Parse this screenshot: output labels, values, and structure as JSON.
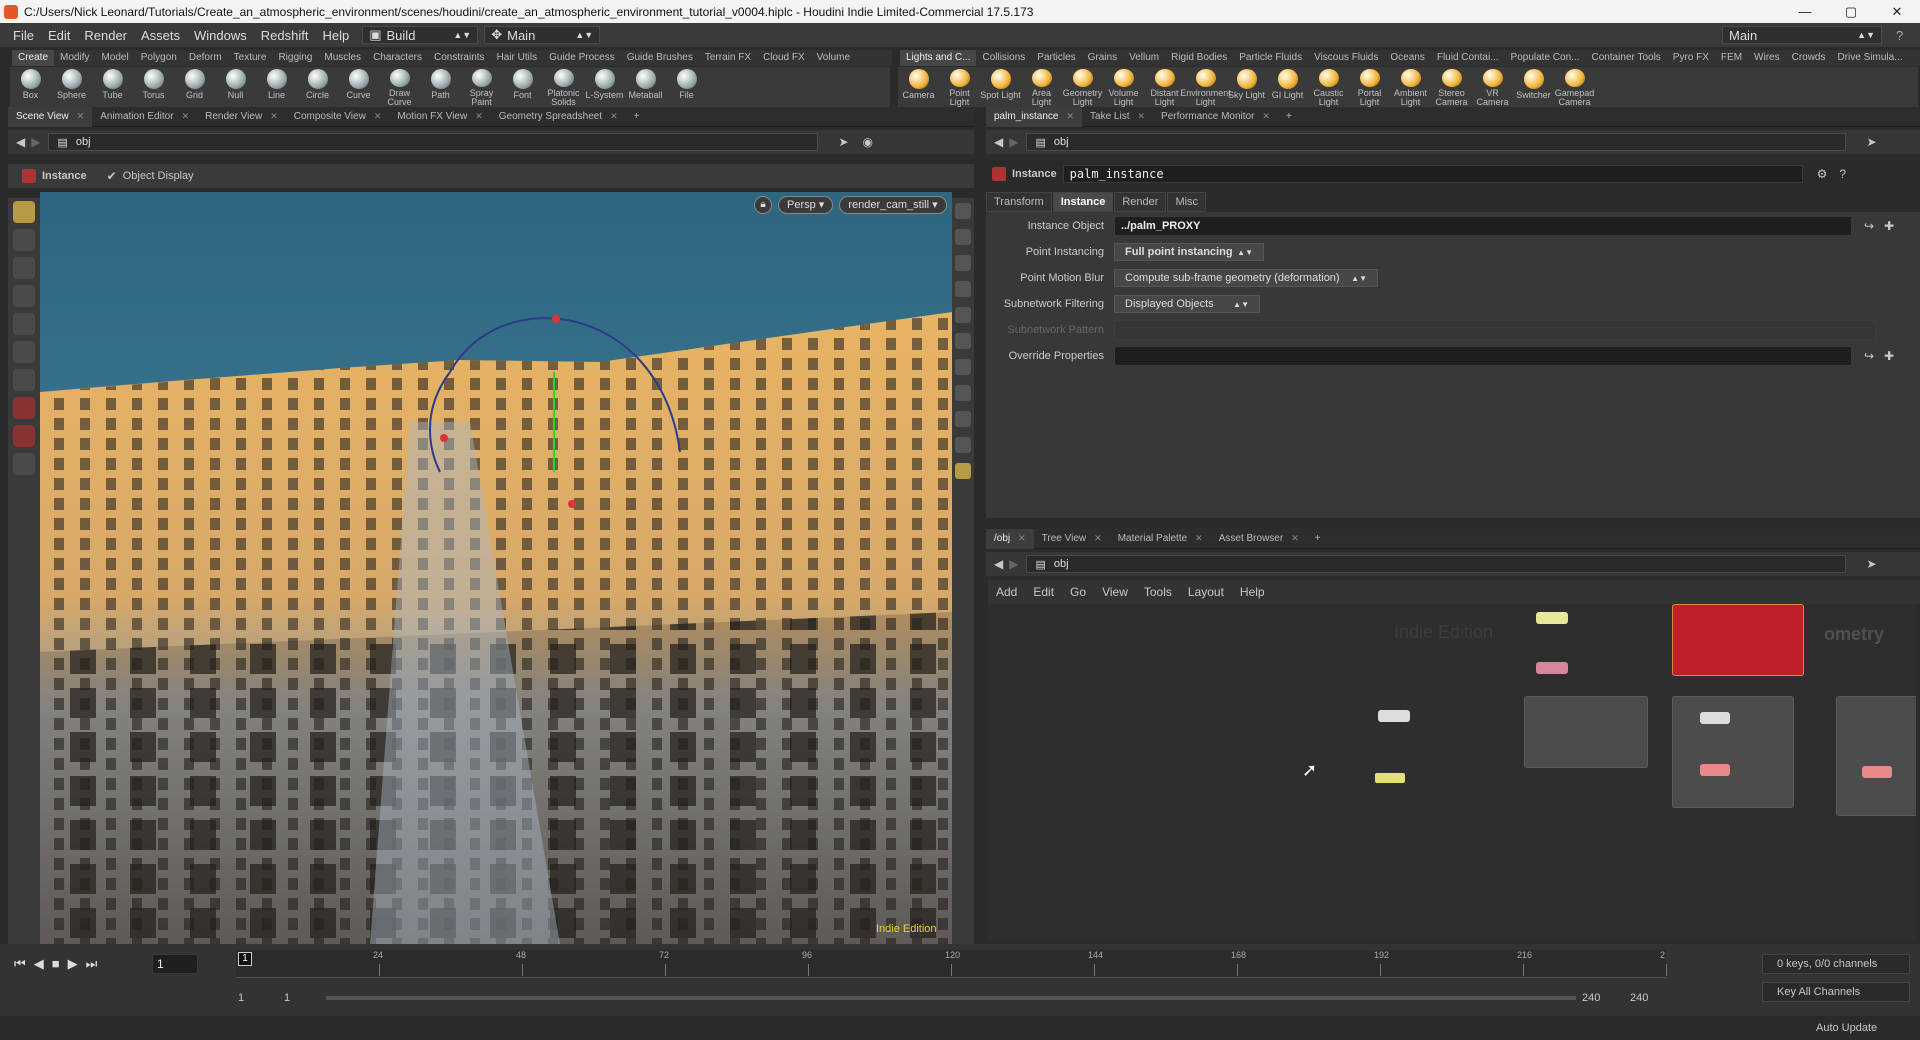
{
  "window": {
    "title": "C:/Users/Nick Leonard/Tutorials/Create_an_atmospheric_environment/scenes/houdini/create_an_atmospheric_environment_tutorial_v0004.hiplc - Houdini Indie Limited-Commercial 17.5.173",
    "min": "—",
    "max": "▢",
    "close": "✕"
  },
  "menu": [
    "File",
    "Edit",
    "Render",
    "Assets",
    "Windows",
    "Redshift",
    "Help"
  ],
  "desktop": {
    "build": "Build",
    "main": "Main",
    "right_main": "Main"
  },
  "shelf_tabs_left": [
    "Create",
    "Modify",
    "Model",
    "Polygon",
    "Deform",
    "Texture",
    "Rigging",
    "Muscles",
    "Characters",
    "Constraints",
    "Hair Utils",
    "Guide Process",
    "Guide Brushes",
    "Terrain FX",
    "Cloud FX",
    "Volume"
  ],
  "shelf_tabs_right": [
    "Lights and C...",
    "Collisions",
    "Particles",
    "Grains",
    "Vellum",
    "Rigid Bodies",
    "Particle Fluids",
    "Viscous Fluids",
    "Oceans",
    "Fluid Contai...",
    "Populate Con...",
    "Container Tools",
    "Pyro FX",
    "FEM",
    "Wires",
    "Crowds",
    "Drive Simula..."
  ],
  "tools_left": [
    "Box",
    "Sphere",
    "Tube",
    "Torus",
    "Grid",
    "Null",
    "Line",
    "Circle",
    "Curve",
    "Draw Curve",
    "Path",
    "Spray Paint",
    "Font",
    "Platonic Solids",
    "L-System",
    "Metaball",
    "File"
  ],
  "tools_right": [
    "Camera",
    "Point Light",
    "Spot Light",
    "Area Light",
    "Geometry Light",
    "Volume Light",
    "Distant Light",
    "Environment Light",
    "Sky Light",
    "GI Light",
    "Caustic Light",
    "Portal Light",
    "Ambient Light",
    "Stereo Camera",
    "VR Camera",
    "Switcher",
    "Gamepad Camera"
  ],
  "left_pane_tabs": [
    "Scene View",
    "Animation Editor",
    "Render View",
    "Composite View",
    "Motion FX View",
    "Geometry Spreadsheet"
  ],
  "left_path": "obj",
  "viewport": {
    "mode": "Instance",
    "object_display": "Object Display",
    "persp": "Persp",
    "camera": "render_cam_still",
    "watermark": "Indie Edition"
  },
  "param_pane_tabs": [
    "palm_instance",
    "Take List",
    "Performance Monitor"
  ],
  "param_path": "obj",
  "param_header": {
    "type": "Instance",
    "name": "palm_instance"
  },
  "param_tabs": [
    "Transform",
    "Instance",
    "Render",
    "Misc"
  ],
  "params": {
    "instance_object_label": "Instance Object",
    "instance_object": "../palm_PROXY",
    "point_instancing_label": "Point Instancing",
    "point_instancing": "Full point instancing",
    "motion_blur_label": "Point Motion Blur",
    "motion_blur": "Compute sub-frame geometry (deformation)",
    "subnet_filter_label": "Subnetwork Filtering",
    "subnet_filter": "Displayed Objects",
    "subnet_pattern_label": "Subnetwork Pattern",
    "override_label": "Override Properties"
  },
  "net_pane_tabs": [
    "/obj",
    "Tree View",
    "Material Palette",
    "Asset Browser"
  ],
  "net_path": "obj",
  "net_menu": [
    "Add",
    "Edit",
    "Go",
    "View",
    "Tools",
    "Layout",
    "Help"
  ],
  "net_watermark": "Indie Edition",
  "net_partial_label": "ometry",
  "timeline": {
    "frame": "1",
    "ticks": [
      "24",
      "48",
      "72",
      "96",
      "120",
      "144",
      "168",
      "192",
      "216",
      "2"
    ],
    "start": "1",
    "start2": "1",
    "end": "240",
    "end2": "240",
    "marker": "1",
    "keys": "0 keys, 0/0 channels",
    "key_all": "Key All Channels",
    "auto_update": "Auto Update"
  }
}
